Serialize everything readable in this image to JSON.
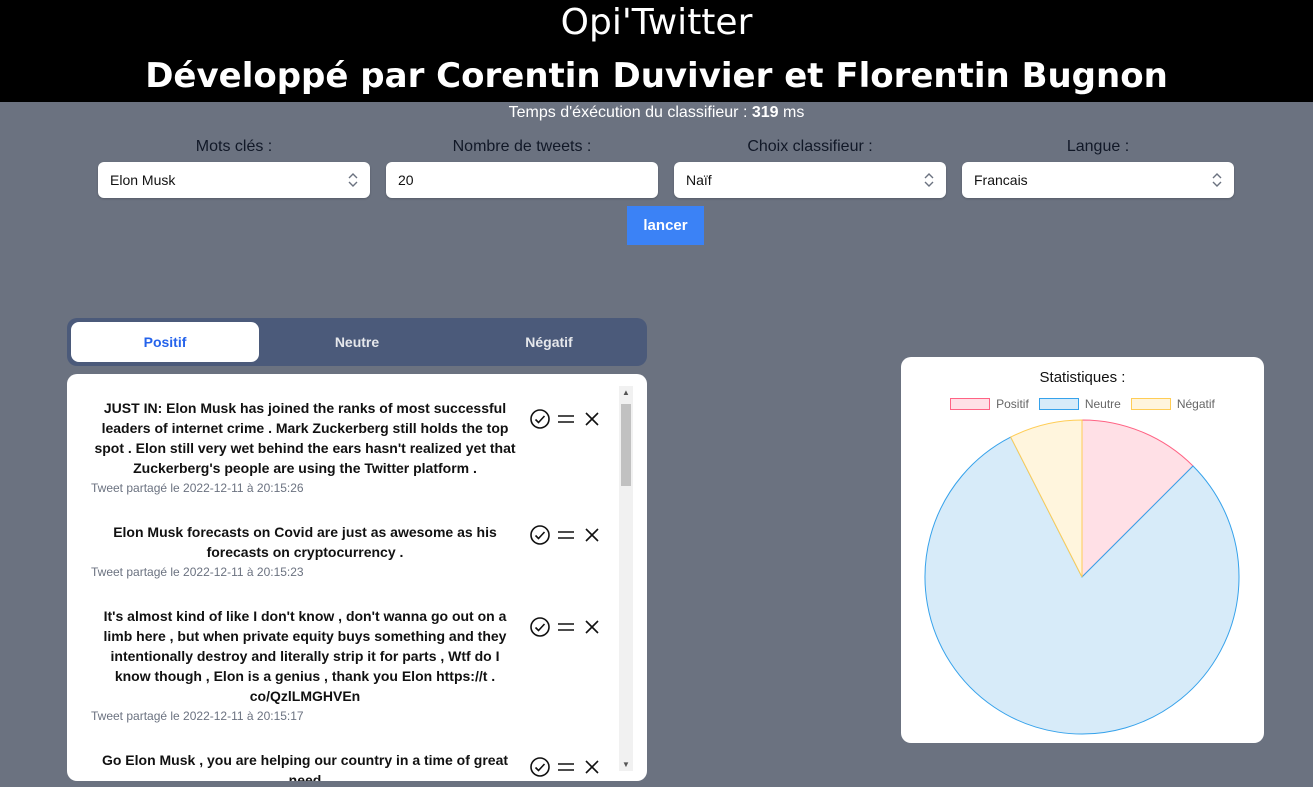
{
  "header": {
    "title": "Opi'Twitter",
    "subtitle": "Développé par Corentin Duvivier et Florentin Bugnon"
  },
  "exec": {
    "label": "Temps d'éxécution du classifieur :",
    "value": "319",
    "unit": "ms"
  },
  "form": {
    "keywords": {
      "label": "Mots clés :",
      "value": "Elon Musk"
    },
    "count": {
      "label": "Nombre de tweets :",
      "value": "20"
    },
    "classifier": {
      "label": "Choix classifieur :",
      "value": "Naïf"
    },
    "language": {
      "label": "Langue :",
      "value": "Francais"
    },
    "launch_label": "lancer"
  },
  "tabs": [
    {
      "label": "Positif",
      "active": true
    },
    {
      "label": "Neutre",
      "active": false
    },
    {
      "label": "Négatif",
      "active": false
    }
  ],
  "tweets": [
    {
      "text": "JUST IN: Elon Musk has joined the ranks of most successful leaders of internet crime . Mark Zuckerberg still holds the top spot . Elon still very wet behind the ears hasn't realized yet that Zuckerberg's people are using the Twitter platform .",
      "date": "Tweet partagé le 2022-12-11 à 20:15:26"
    },
    {
      "text": "Elon Musk forecasts on Covid are just as awesome as his forecasts on cryptocurrency .",
      "date": "Tweet partagé le 2022-12-11 à 20:15:23"
    },
    {
      "text": "It's almost kind of like I don't know , don't wanna go out on a limb here , but when private equity buys something and they intentionally destroy and literally strip it for parts , Wtf do I know though , Elon is a genius , thank you Elon https://t . co/QzlLMGHVEn",
      "date": "Tweet partagé le 2022-12-11 à 20:15:17"
    },
    {
      "text": "Go Elon Musk , you are helping our country in a time of great need",
      "date": ""
    }
  ],
  "stats": {
    "title": "Statistiques :",
    "legend": [
      "Positif",
      "Neutre",
      "Négatif"
    ]
  },
  "chart_data": {
    "type": "pie",
    "categories": [
      "Positif",
      "Neutre",
      "Négatif"
    ],
    "values": [
      2.5,
      16,
      1.5
    ],
    "colors": {
      "Positif": {
        "fill": "#ffe0e6",
        "stroke": "#ff6384"
      },
      "Neutre": {
        "fill": "#d7ebf9",
        "stroke": "#36a2eb"
      },
      "Négatif": {
        "fill": "#fff5dd",
        "stroke": "#ffcd56"
      }
    },
    "legend_position": "top"
  }
}
